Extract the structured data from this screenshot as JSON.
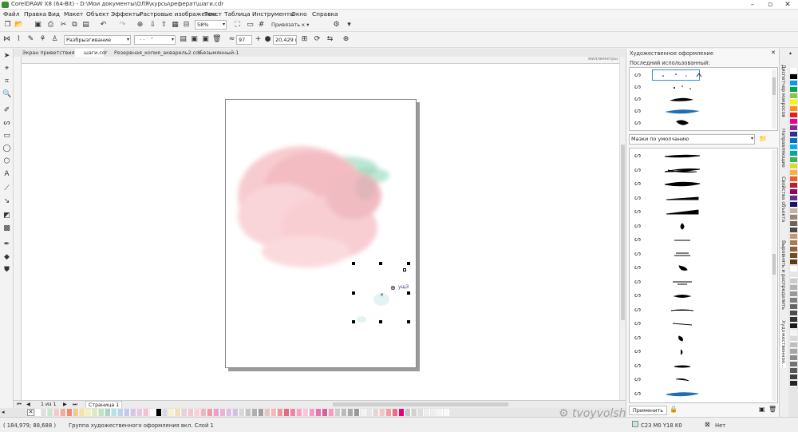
{
  "window": {
    "title": "CorelDRAW X8 (64-Bit) - D:\\Мои документы\\ОЛЯ\\курсы\\реферат\\шаги.cdr"
  },
  "menu": [
    "Файл",
    "Правка",
    "Вид",
    "Макет",
    "Объект",
    "Эффекты",
    "Растровые изображения",
    "Текст",
    "Таблица",
    "Инструменты",
    "Окно",
    "Справка"
  ],
  "toolbar": {
    "zoom": "58%",
    "snap": "Привязать к"
  },
  "propertybar": {
    "mode": "Разбрызгивание",
    "count": "97",
    "size": "20,429 мм"
  },
  "tabs": [
    "Экран приветствия",
    "шаги.cdr",
    "Резервная_копия_акварель2.cdr",
    "Безымянный-1"
  ],
  "ruler": {
    "unit": "миллиметры"
  },
  "selection": {
    "label": "ущЗ"
  },
  "bottombar": {
    "page_of": "1 из 1",
    "page_tab": "Страница 1"
  },
  "status": {
    "coords": "( 184,979; 88,688 )",
    "info": "Группа художественного оформления вкл. Слой 1",
    "fill": "C23 M0 Y18 K0",
    "outline": "Нет"
  },
  "docker": {
    "title": "Художественное оформление",
    "recent_label": "Последний использованный:",
    "category": "Мазки по умолчанию",
    "apply": "Применить"
  },
  "right_tabs": [
    "Диспетчер макросов",
    "Направляющие",
    "Свойства объекта",
    "Выровнять и распределить",
    "Художественное..."
  ],
  "watermark": "tvoyvolshebnik.livemaster.ru",
  "palette_bottom": [
    "#ffffff",
    "#e0e0e0",
    "#c9e8cf",
    "#f6c9c9",
    "#f4a99a",
    "#f08a7a",
    "#f7c98f",
    "#f5e5a0",
    "#f5f0c0",
    "#d9ecc0",
    "#bfe2bf",
    "#a6d8c4",
    "#b5e2e9",
    "#bcd5ef",
    "#c7c9ec",
    "#d6c6ea",
    "#e9c6e2",
    "#f2c2d2",
    "#ffffff",
    "#000000",
    "#d9d9d9",
    "#f7f3c6",
    "#efe0b6",
    "#e8d0d8",
    "#f2c7cf",
    "#f7d3d9",
    "#f2b5c0",
    "#ee9aa8",
    "#e9a0c4",
    "#e8b3d5",
    "#ddc0e4",
    "#cfc2e8",
    "#d8d8d8",
    "#c4c4c4",
    "#b0b0b0",
    "#a0a0a0",
    "#e8c3c3",
    "#f4b9c0",
    "#ef96a5",
    "#e46c82",
    "#ee84a6",
    "#f3a6c2",
    "#f7c6da",
    "#ed9dc6",
    "#e179ae",
    "#d761a0",
    "#f19dbb",
    "#cccccc",
    "#bbbbbb",
    "#aaaaaa",
    "#999999",
    "#f2f2f2",
    "#e6e6e6",
    "#e9d2d2",
    "#f5c5c5",
    "#f0a0a0",
    "#ef6f7f",
    "#e6007e",
    "#c7c7c7",
    "#d1d1d1",
    "#dddddd",
    "#ededed",
    "#eeeeee",
    "#f5f5f5",
    "#fafafa"
  ],
  "palette_right": [
    "#ffffff",
    "#000000",
    "#00a0e9",
    "#00a651",
    "#8dc63f",
    "#fff200",
    "#f7941d",
    "#ed1c24",
    "#ec008c",
    "#92278f",
    "#2e3192",
    "#0072bc",
    "#00aeef",
    "#00a99d",
    "#39b54a",
    "#d7df23",
    "#fbb040",
    "#f15a29",
    "#be1e2d",
    "#9e005d",
    "#662d91",
    "#1b1464",
    "#c2b59b",
    "#998675",
    "#736357",
    "#534741",
    "#c69c6d",
    "#a67c52",
    "#8c6239",
    "#754c24",
    "#603813",
    "#ffffff",
    "#e6e6e6",
    "#cccccc",
    "#b3b3b3",
    "#999999",
    "#808080",
    "#666666",
    "#4d4d4d",
    "#333333",
    "#1a1a1a",
    "#f2f2f2",
    "#d9d9d9",
    "#bfbfbf",
    "#a6a6a6",
    "#8c8c8c",
    "#737373",
    "#595959",
    "#404040",
    "#262626"
  ]
}
